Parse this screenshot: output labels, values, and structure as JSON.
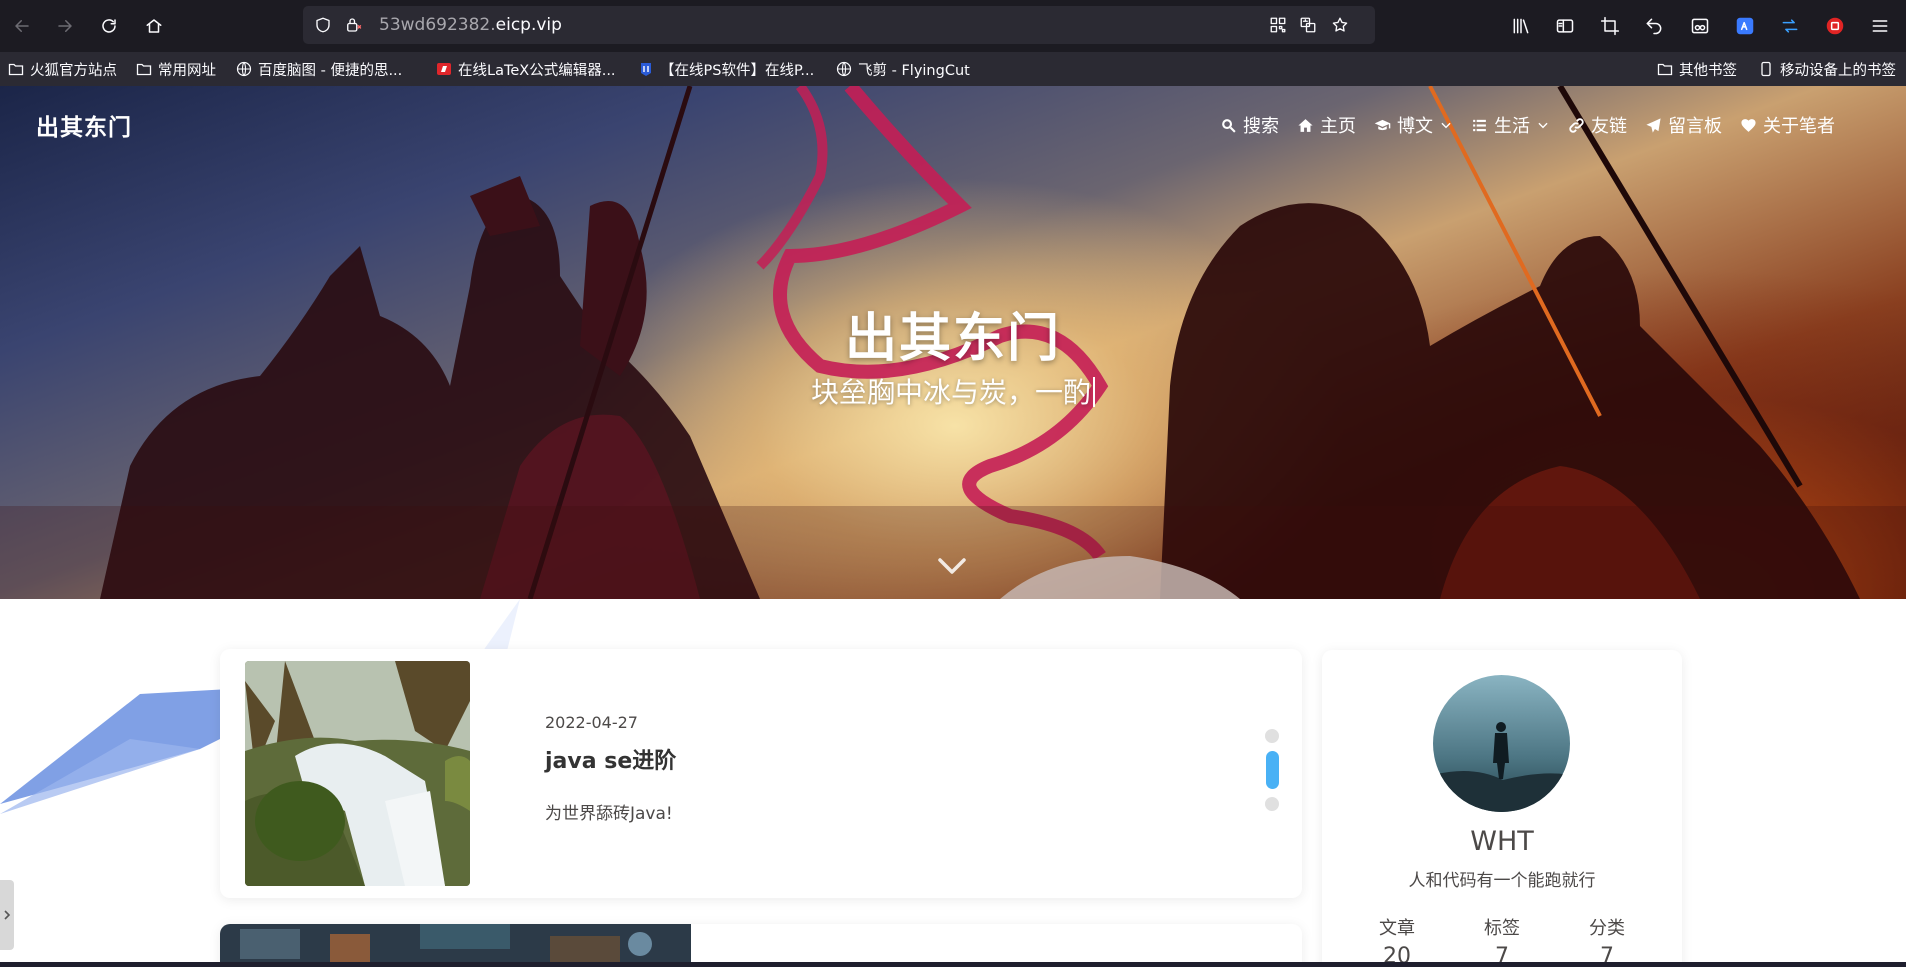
{
  "browser": {
    "url_prefix": "53wd692382.",
    "url_domain": "eicp.vip",
    "bookmarks": [
      {
        "label": "火狐官方站点",
        "icon": "folder-icon"
      },
      {
        "label": "常用网址",
        "icon": "folder-icon"
      },
      {
        "label": "百度脑图 - 便捷的思...",
        "icon": "globe-icon"
      },
      {
        "label": "在线LaTeX公式编辑器...",
        "icon": "latex-icon"
      },
      {
        "label": "【在线PS软件】在线P...",
        "icon": "ps-icon"
      },
      {
        "label": "飞剪 - FlyingCut",
        "icon": "globe-icon"
      }
    ],
    "bookmarks_right": [
      {
        "label": "其他书签",
        "icon": "folder-icon"
      },
      {
        "label": "移动设备上的书签",
        "icon": "mobile-icon"
      }
    ]
  },
  "site": {
    "brand": "出其东门",
    "menu": [
      {
        "label": "搜索",
        "icon": "search-icon",
        "dropdown": false
      },
      {
        "label": "主页",
        "icon": "home-icon",
        "dropdown": false
      },
      {
        "label": "博文",
        "icon": "graduation-cap-icon",
        "dropdown": true
      },
      {
        "label": "生活",
        "icon": "list-icon",
        "dropdown": true
      },
      {
        "label": "友链",
        "icon": "link-icon",
        "dropdown": false
      },
      {
        "label": "留言板",
        "icon": "paper-plane-icon",
        "dropdown": false
      },
      {
        "label": "关于笔者",
        "icon": "heart-icon",
        "dropdown": false
      }
    ],
    "hero_title": "出其东门",
    "hero_subtitle": "块垒胸中冰与炭，一酌"
  },
  "posts": [
    {
      "date": "2022-04-27",
      "title": "java se进阶",
      "description": "为世界舔砖Java!"
    }
  ],
  "profile": {
    "name": "WHT",
    "bio": "人和代码有一个能跑就行",
    "stats": [
      {
        "label": "文章",
        "value": "20"
      },
      {
        "label": "标签",
        "value": "7"
      },
      {
        "label": "分类",
        "value": "7"
      }
    ]
  },
  "colors": {
    "accent": "#49b1f5",
    "browser_toolbar": "#1c1b22",
    "browser_urlbar": "#2b2a33"
  }
}
